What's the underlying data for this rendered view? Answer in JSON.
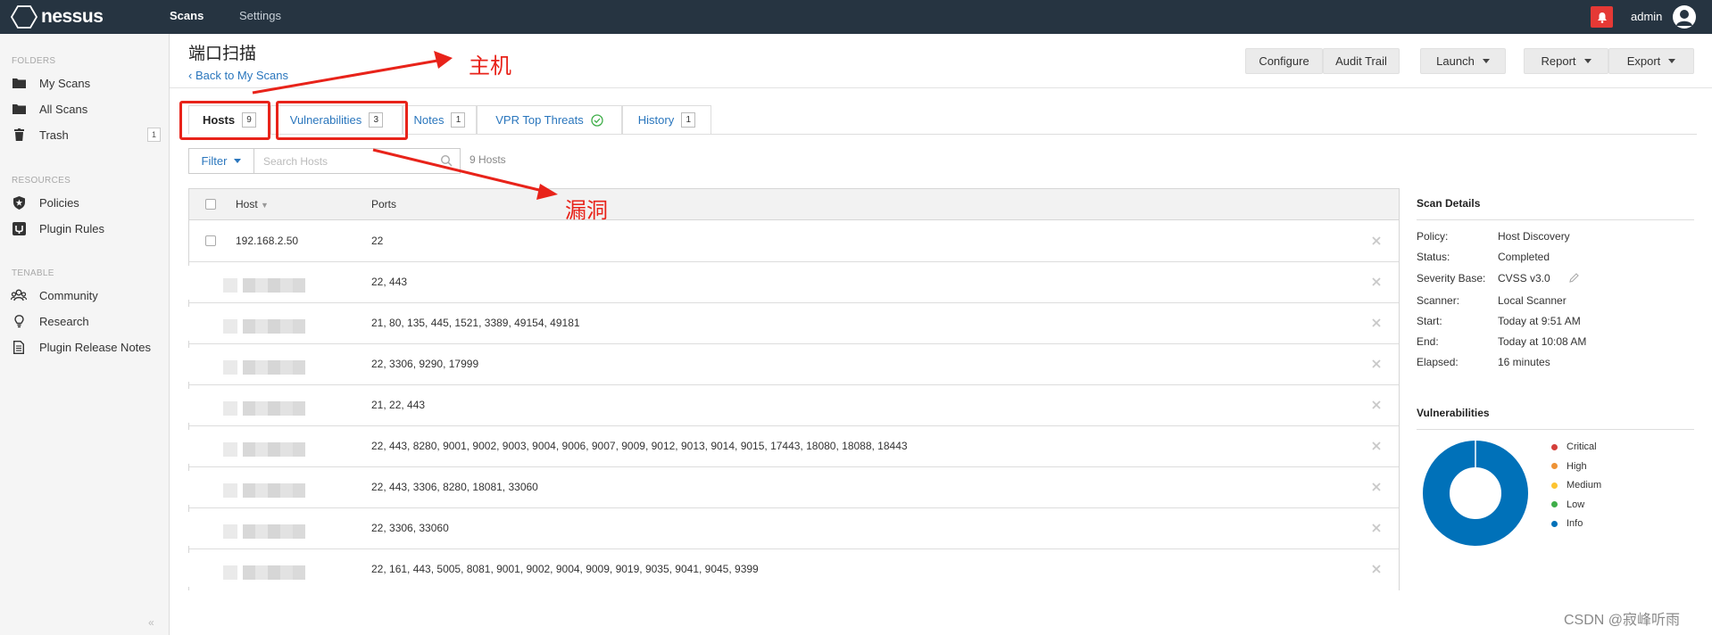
{
  "app": {
    "logo_text": "nessus",
    "nav": [
      "Scans",
      "Settings"
    ],
    "user": "admin"
  },
  "sidebar": {
    "folders_label": "FOLDERS",
    "folders": [
      {
        "label": "My Scans",
        "icon": "folder-icon"
      },
      {
        "label": "All Scans",
        "icon": "folder-icon"
      },
      {
        "label": "Trash",
        "icon": "trash-icon",
        "count": "1"
      }
    ],
    "resources_label": "RESOURCES",
    "resources": [
      {
        "label": "Policies",
        "icon": "shield-icon"
      },
      {
        "label": "Plugin Rules",
        "icon": "plugin-icon"
      }
    ],
    "tenable_label": "TENABLE",
    "tenable": [
      {
        "label": "Community",
        "icon": "community-icon"
      },
      {
        "label": "Research",
        "icon": "lightbulb-icon"
      },
      {
        "label": "Plugin Release Notes",
        "icon": "document-icon"
      }
    ],
    "collapse": "«"
  },
  "header": {
    "title": "端口扫描",
    "back": "Back to My Scans",
    "buttons": {
      "configure": "Configure",
      "audit_trail": "Audit Trail",
      "launch": "Launch",
      "report": "Report",
      "export": "Export"
    }
  },
  "tabs": [
    {
      "label": "Hosts",
      "count": "9"
    },
    {
      "label": "Vulnerabilities",
      "count": "3"
    },
    {
      "label": "Notes",
      "count": "1"
    },
    {
      "label": "VPR Top Threats"
    },
    {
      "label": "History",
      "count": "1"
    }
  ],
  "filter": {
    "label": "Filter",
    "placeholder": "Search Hosts",
    "count": "9 Hosts"
  },
  "table": {
    "columns": [
      "Host",
      "Ports"
    ],
    "rows": [
      {
        "host": "192.168.2.50",
        "ports": "22"
      },
      {
        "host": "",
        "ports": "22, 443"
      },
      {
        "host": "",
        "ports": "21, 80, 135, 445, 1521, 3389, 49154, 49181"
      },
      {
        "host": "",
        "ports": "22, 3306, 9290, 17999"
      },
      {
        "host": "",
        "ports": "21, 22, 443"
      },
      {
        "host": "",
        "ports": "22, 443, 8280, 9001, 9002, 9003, 9004, 9006, 9007, 9009, 9012, 9013, 9014, 9015, 17443, 18080, 18088, 18443"
      },
      {
        "host": "",
        "ports": "22, 443, 3306, 8280, 18081, 33060"
      },
      {
        "host": "",
        "ports": "22, 3306, 33060"
      },
      {
        "host": "",
        "ports": "22, 161, 443, 5005, 8081, 9001, 9002, 9004, 9009, 9019, 9035, 9041, 9045, 9399"
      }
    ]
  },
  "scan_details": {
    "title": "Scan Details",
    "items": [
      {
        "label": "Policy:",
        "value": "Host Discovery"
      },
      {
        "label": "Status:",
        "value": "Completed"
      },
      {
        "label": "Severity Base:",
        "value": "CVSS v3.0"
      },
      {
        "label": "Scanner:",
        "value": "Local Scanner"
      },
      {
        "label": "Start:",
        "value": "Today at 9:51 AM"
      },
      {
        "label": "End:",
        "value": "Today at 10:08 AM"
      },
      {
        "label": "Elapsed:",
        "value": "16 minutes"
      }
    ]
  },
  "vulnerabilities": {
    "title": "Vulnerabilities",
    "legend": [
      {
        "label": "Critical",
        "color": "#d43f3a"
      },
      {
        "label": "High",
        "color": "#ee9336"
      },
      {
        "label": "Medium",
        "color": "#fdc431"
      },
      {
        "label": "Low",
        "color": "#3fae49"
      },
      {
        "label": "Info",
        "color": "#0071b9"
      }
    ],
    "donut_share": {
      "Critical": 0,
      "High": 0,
      "Medium": 0,
      "Low": 0,
      "Info": 1
    }
  },
  "annotations": {
    "host_label": "主机",
    "vuln_label": "漏洞",
    "color": "#e8231a"
  },
  "watermark": "CSDN @寂峰听雨",
  "colors": {
    "topbar": "#263441",
    "link": "#2a76bd",
    "info": "#0071b9"
  }
}
